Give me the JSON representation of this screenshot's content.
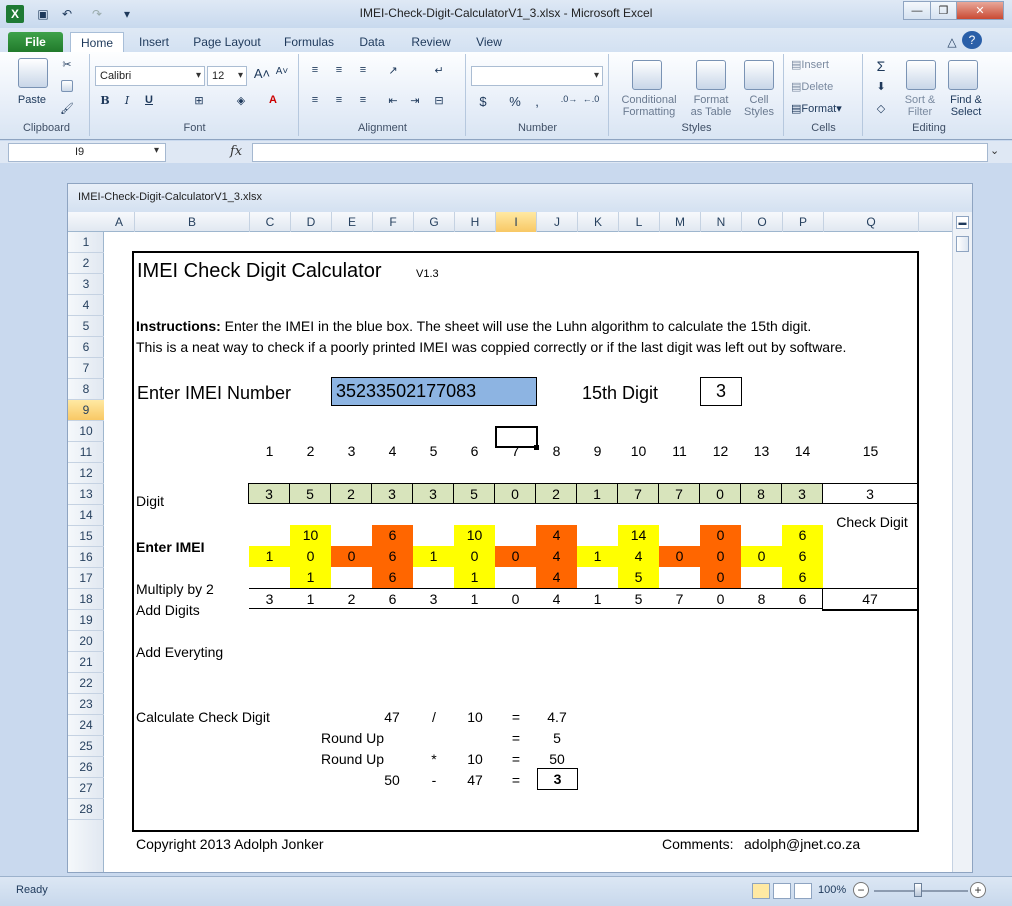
{
  "window": {
    "title": "IMEI-Check-Digit-CalculatorV1_3.xlsx  -  Microsoft Excel"
  },
  "tabs": [
    "File",
    "Home",
    "Insert",
    "Page Layout",
    "Formulas",
    "Data",
    "Review",
    "View"
  ],
  "ribbon": {
    "clipboard": {
      "label": "Clipboard",
      "paste": "Paste"
    },
    "font": {
      "label": "Font",
      "name": "Calibri",
      "size": "12",
      "bold": "B",
      "italic": "I",
      "underline": "U"
    },
    "alignment": {
      "label": "Alignment"
    },
    "number": {
      "label": "Number",
      "currency": "$",
      "percent": "%",
      "comma": ","
    },
    "styles": {
      "label": "Styles",
      "conditional": "Conditional\nFormatting",
      "format_table": "Format\nas Table",
      "cell_styles": "Cell\nStyles"
    },
    "cells": {
      "label": "Cells",
      "insert": "Insert",
      "delete": "Delete",
      "format": "Format"
    },
    "editing": {
      "label": "Editing",
      "sort": "Sort &\nFilter",
      "find": "Find &\nSelect"
    }
  },
  "formula_bar": {
    "name_box": "I9",
    "fx": "fx",
    "value": ""
  },
  "workbook": {
    "title": "IMEI-Check-Digit-CalculatorV1_3.xlsx"
  },
  "columns": [
    "A",
    "B",
    "C",
    "D",
    "E",
    "F",
    "G",
    "H",
    "I",
    "J",
    "K",
    "L",
    "M",
    "N",
    "O",
    "P",
    "Q"
  ],
  "rows": [
    "1",
    "2",
    "3",
    "4",
    "5",
    "6",
    "7",
    "8",
    "9",
    "10",
    "11",
    "12",
    "13",
    "14",
    "15",
    "16",
    "17",
    "18",
    "19",
    "20",
    "21",
    "22",
    "23",
    "24",
    "25",
    "26",
    "27",
    "28"
  ],
  "selected": {
    "column": "I",
    "row": "9"
  },
  "sheet": {
    "title": "IMEI Check Digit Calculator",
    "version": "V1.3",
    "instr_bold": "Instructions:",
    "instr1": " Enter the IMEI in the blue box. The sheet will use the Luhn algorithm to calculate the 15th digit.",
    "instr2": "This is a neat way to check if a poorly printed IMEI was coppied correctly or if the last digit was left out by software.",
    "enter_label": "Enter IMEI Number",
    "imei_value": "35233502177083",
    "digit15_label": "15th Digit",
    "digit15_value": "3",
    "digit_label": "Digit",
    "digit_numbers": [
      "1",
      "2",
      "3",
      "4",
      "5",
      "6",
      "7",
      "8",
      "9",
      "10",
      "11",
      "12",
      "13",
      "14",
      "15"
    ],
    "check_digit_label": "Check Digit",
    "enter_imei_label": "Enter IMEI",
    "imei_digits": [
      "3",
      "5",
      "2",
      "3",
      "3",
      "5",
      "0",
      "2",
      "1",
      "7",
      "7",
      "0",
      "8",
      "3",
      "3"
    ],
    "multiply_label": "Multiply by 2",
    "multiply_values": [
      "",
      "10",
      "",
      "6",
      "",
      "10",
      "",
      "4",
      "",
      "14",
      "",
      "0",
      "",
      "6"
    ],
    "add_digits_label": "Add Digits",
    "add_digits_row16": [
      "1",
      "0",
      "0",
      "6",
      "1",
      "0",
      "0",
      "4",
      "1",
      "4",
      "0",
      "0",
      "0",
      "6"
    ],
    "add_digits_row17": [
      "",
      "1",
      "",
      "6",
      "",
      "1",
      "",
      "4",
      "",
      "5",
      "",
      "0",
      "",
      "6"
    ],
    "add_everything_label": "Add Everyting",
    "add_everything": [
      "3",
      "1",
      "2",
      "6",
      "3",
      "1",
      "0",
      "4",
      "1",
      "5",
      "7",
      "0",
      "8",
      "6"
    ],
    "sum_total": "47",
    "calc_label": "Calculate Check Digit",
    "calc": {
      "r21": {
        "a": "47",
        "op": "/",
        "b": "10",
        "eq": "=",
        "res": "4.7"
      },
      "r22": {
        "label": "Round Up",
        "eq": "=",
        "res": "5"
      },
      "r23": {
        "label": "Round Up",
        "op": "*",
        "b": "10",
        "eq": "=",
        "res": "50"
      },
      "r24": {
        "a": "50",
        "op": "-",
        "b": "47",
        "eq": "=",
        "res": "3"
      }
    },
    "copyright": "Copyright 2013 Adolph Jonker",
    "comments_label": "Comments:",
    "comments_email": "adolph@jnet.co.za"
  },
  "status": {
    "ready": "Ready",
    "zoom": "100%"
  },
  "colors": {
    "imei_box": "#8db4e2",
    "green": "#d8e4bc",
    "yellow": "#ffff00",
    "orange": "#ff6600"
  }
}
